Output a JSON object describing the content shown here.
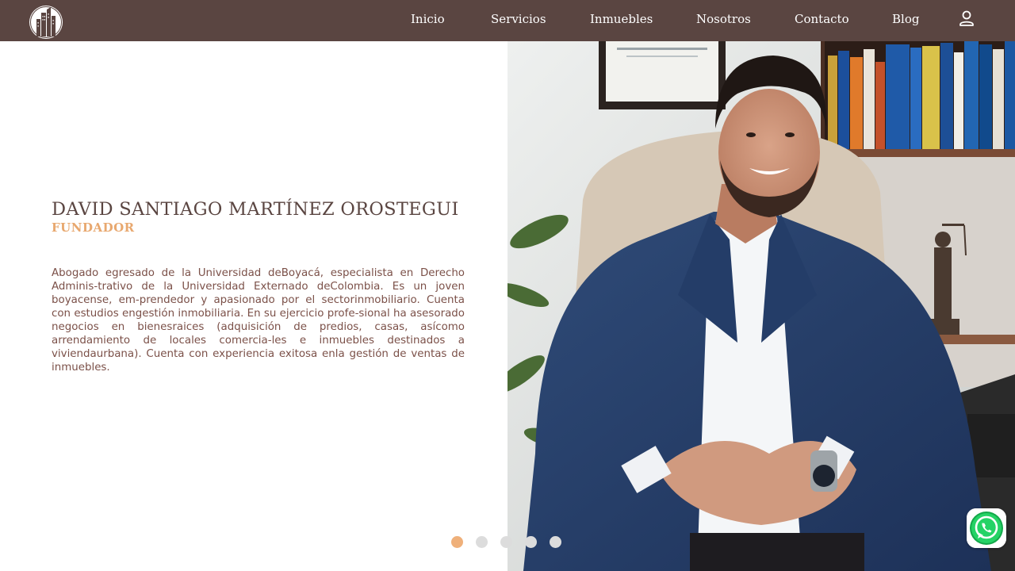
{
  "header": {
    "background": "#5a4541",
    "logo_icon": "building-logo-icon",
    "nav": [
      {
        "label": "Inicio"
      },
      {
        "label": "Servicios"
      },
      {
        "label": "Inmuebles"
      },
      {
        "label": "Nosotros"
      },
      {
        "label": "Contacto"
      },
      {
        "label": "Blog"
      }
    ],
    "user_icon": "user-icon"
  },
  "profile": {
    "name": "DAVID SANTIAGO MARTÍNEZ OROSTEGUI",
    "role": "FUNDADOR",
    "bio": "Abogado egresado de la Universidad deBoyacá, especialista en Derecho Adminis-trativo de la Universidad Externado deColombia. Es un joven boyacense, em-prendedor y apasionado por el sectorinmobiliario. Cuenta con estudios engestión inmobiliaria. En su ejercicio profe-sional ha asesorado negocios en bienesraices (adquisición de predios, casas, asícomo arrendamiento de locales comercia-les e inmuebles destinados a viviendaurbana). Cuenta con experiencia exitosa enla gestión de ventas de inmuebles.",
    "photo_icon": "founder-portrait-photo"
  },
  "slider": {
    "total": 5,
    "active_index": 0,
    "active_color": "#efb07a",
    "inactive_color": "#dcdcdc"
  },
  "whatsapp": {
    "icon": "whatsapp-icon",
    "color": "#25d366"
  },
  "colors": {
    "name": "#5a4541",
    "role": "#e8a86f",
    "bio": "#7b5048"
  }
}
